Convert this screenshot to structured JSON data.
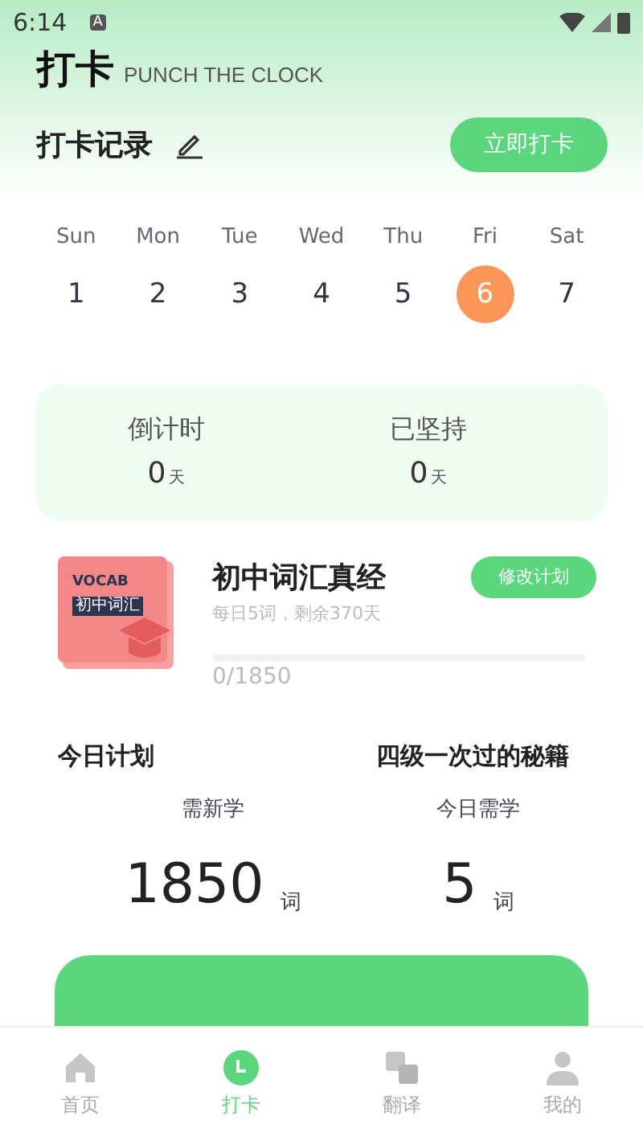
{
  "status_bar": {
    "time": "6:14",
    "badge": "A"
  },
  "header": {
    "title": "打卡",
    "subtitle": "PUNCH THE CLOCK"
  },
  "record": {
    "label": "打卡记录",
    "button": "立即打卡"
  },
  "week": [
    {
      "day": "Sun",
      "date": "1",
      "selected": false
    },
    {
      "day": "Mon",
      "date": "2",
      "selected": false
    },
    {
      "day": "Tue",
      "date": "3",
      "selected": false
    },
    {
      "day": "Wed",
      "date": "4",
      "selected": false
    },
    {
      "day": "Thu",
      "date": "5",
      "selected": false
    },
    {
      "day": "Fri",
      "date": "6",
      "selected": true
    },
    {
      "day": "Sat",
      "date": "7",
      "selected": false
    }
  ],
  "stats": [
    {
      "label": "倒计时",
      "value": "0",
      "unit": "天"
    },
    {
      "label": "已坚持",
      "value": "0",
      "unit": "天"
    }
  ],
  "book": {
    "cover_title": "VOCAB",
    "cover_tag": "初中词汇",
    "title": "初中词汇真经",
    "plan": "每日5词，剩余370天",
    "button": "修改计划",
    "progress": "0/1850"
  },
  "plan": {
    "title": "今日计划",
    "link": "四级一次过的秘籍",
    "items": [
      {
        "label": "需新学",
        "value": "1850",
        "unit": "词"
      },
      {
        "label": "今日需学",
        "value": "5",
        "unit": "词"
      }
    ]
  },
  "tabs": [
    {
      "label": "首页",
      "kind": "home",
      "selected": false
    },
    {
      "label": "打卡",
      "kind": "clock",
      "selected": true
    },
    {
      "label": "翻译",
      "kind": "translate",
      "selected": false
    },
    {
      "label": "我的",
      "kind": "user",
      "selected": false
    }
  ]
}
